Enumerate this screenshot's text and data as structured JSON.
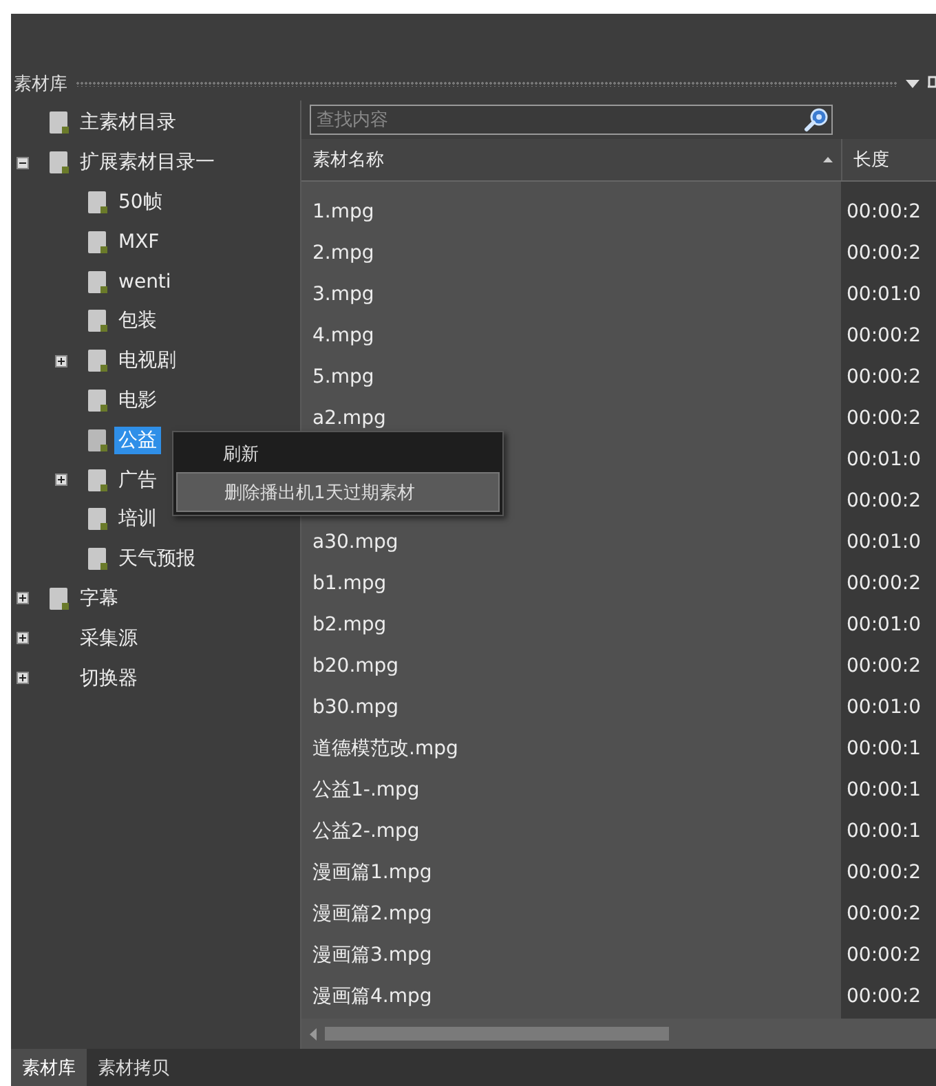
{
  "panel": {
    "title": "素材库"
  },
  "tree": {
    "items": [
      {
        "label": "主素材目录",
        "kind": "folder",
        "selected": false
      },
      {
        "label": "扩展素材目录一",
        "kind": "folder",
        "expanded": true,
        "selected": false,
        "children": [
          {
            "label": "50帧",
            "kind": "folder",
            "selected": false
          },
          {
            "label": "MXF",
            "kind": "folder",
            "selected": false
          },
          {
            "label": "wenti",
            "kind": "folder",
            "selected": false
          },
          {
            "label": "包装",
            "kind": "folder",
            "selected": false
          },
          {
            "label": "电视剧",
            "kind": "folder",
            "expanded": false,
            "selected": false
          },
          {
            "label": "电影",
            "kind": "folder",
            "selected": false
          },
          {
            "label": "公益",
            "kind": "folder",
            "selected": true
          },
          {
            "label": "广告",
            "kind": "folder",
            "expanded": false,
            "selected": false
          },
          {
            "label": "培训",
            "kind": "folder",
            "selected": false
          },
          {
            "label": "天气预报",
            "kind": "folder",
            "selected": false
          }
        ]
      },
      {
        "label": "字幕",
        "kind": "folder",
        "expanded": false,
        "selected": false
      },
      {
        "label": "采集源",
        "kind": "plain",
        "expanded": false,
        "selected": false
      },
      {
        "label": "切换器",
        "kind": "plain",
        "expanded": false,
        "selected": false
      }
    ]
  },
  "search": {
    "placeholder": "查找内容"
  },
  "table": {
    "columns": [
      {
        "label": "素材名称",
        "sorted": true
      },
      {
        "label": "长度",
        "sorted": false
      }
    ],
    "rows": [
      {
        "name": "1.mpg",
        "length": "00:00:2"
      },
      {
        "name": "2.mpg",
        "length": "00:00:2"
      },
      {
        "name": "3.mpg",
        "length": "00:01:0"
      },
      {
        "name": "4.mpg",
        "length": "00:00:2"
      },
      {
        "name": "5.mpg",
        "length": "00:00:2"
      },
      {
        "name": "a2.mpg",
        "length": "00:00:2"
      },
      {
        "length": "00:01:0"
      },
      {
        "length": "00:00:2"
      },
      {
        "name": "a30.mpg",
        "length": "00:01:0"
      },
      {
        "name": "b1.mpg",
        "length": "00:00:2"
      },
      {
        "name": "b2.mpg",
        "length": "00:01:0"
      },
      {
        "name": "b20.mpg",
        "length": "00:00:2"
      },
      {
        "name": "b30.mpg",
        "length": "00:01:0"
      },
      {
        "name": "道德模范改.mpg",
        "length": "00:00:1"
      },
      {
        "name": "公益1-.mpg",
        "length": "00:00:1"
      },
      {
        "name": "公益2-.mpg",
        "length": "00:00:1"
      },
      {
        "name": "漫画篇1.mpg",
        "length": "00:00:2"
      },
      {
        "name": "漫画篇2.mpg",
        "length": "00:00:2"
      },
      {
        "name": "漫画篇3.mpg",
        "length": "00:00:2"
      },
      {
        "name": "漫画篇4.mpg",
        "length": "00:00:2"
      }
    ]
  },
  "context_menu": {
    "items": [
      {
        "label": "刷新",
        "selected": false
      },
      {
        "label": "删除播出机1天过期素材",
        "selected": true
      }
    ]
  },
  "bottom_tabs": [
    {
      "label": "素材库",
      "selected": true
    },
    {
      "label": "素材拷贝",
      "selected": false
    }
  ]
}
